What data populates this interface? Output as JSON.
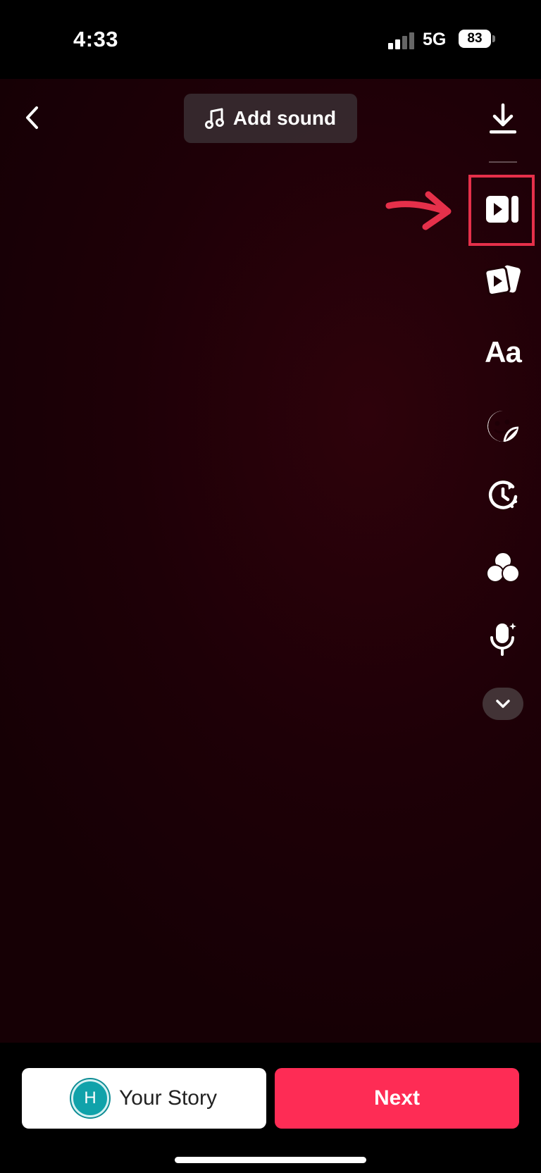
{
  "status_bar": {
    "time": "4:33",
    "network": "5G",
    "battery_level": "83"
  },
  "header": {
    "back_icon": "chevron-left-icon",
    "add_sound_icon": "music-note-icon",
    "add_sound_label": "Add sound"
  },
  "toolbar": {
    "items": [
      {
        "icon": "download-icon"
      },
      {
        "icon": "video-clip-edit-icon",
        "highlighted": true
      },
      {
        "icon": "templates-icon"
      },
      {
        "icon": "text-icon",
        "label": "Aa"
      },
      {
        "icon": "sticker-icon"
      },
      {
        "icon": "timer-icon"
      },
      {
        "icon": "filters-icon"
      },
      {
        "icon": "voice-effects-icon"
      },
      {
        "icon": "chevron-down-icon"
      }
    ],
    "annotation_color": "#e5304a"
  },
  "footer": {
    "story_avatar_initial": "H",
    "story_label": "Your Story",
    "next_label": "Next"
  },
  "colors": {
    "accent": "#fe2c55",
    "avatar": "#10a2aa",
    "background": "#1e0007"
  }
}
